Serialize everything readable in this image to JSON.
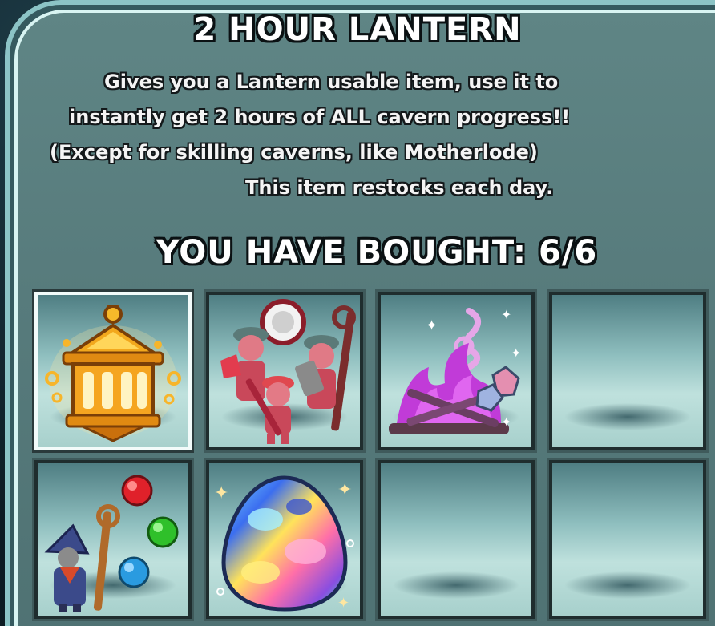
{
  "shop_item": {
    "title": "2 HOUR LANTERN",
    "description_lines": [
      "Gives you a Lantern usable item, use it to",
      "instantly get 2 hours of ALL cavern progress!!",
      "(Except for skilling caverns, like Motherlode)",
      "This item restocks each day."
    ]
  },
  "purchase": {
    "label": "YOU HAVE BOUGHT: 6/6",
    "bought": 6,
    "limit": 6
  },
  "slots": [
    {
      "icon": "golden-lantern-icon",
      "filled": true,
      "selected": true
    },
    {
      "icon": "warrior-party-icon",
      "filled": true,
      "selected": false
    },
    {
      "icon": "purple-campfire-icon",
      "filled": true,
      "selected": false
    },
    {
      "icon": "",
      "filled": false,
      "selected": false
    },
    {
      "icon": "wizard-orbs-icon",
      "filled": true,
      "selected": false
    },
    {
      "icon": "rainbow-egg-icon",
      "filled": true,
      "selected": false
    },
    {
      "icon": "",
      "filled": false,
      "selected": false
    },
    {
      "icon": "",
      "filled": false,
      "selected": false
    }
  ],
  "colors": {
    "panel": "#577b7c",
    "panel_border": "#d8f4f2",
    "slot_bg": "#a7d0cc",
    "text": "#ffffff",
    "lantern_gold": "#f2a81d",
    "fire_purple": "#c13bd8"
  }
}
